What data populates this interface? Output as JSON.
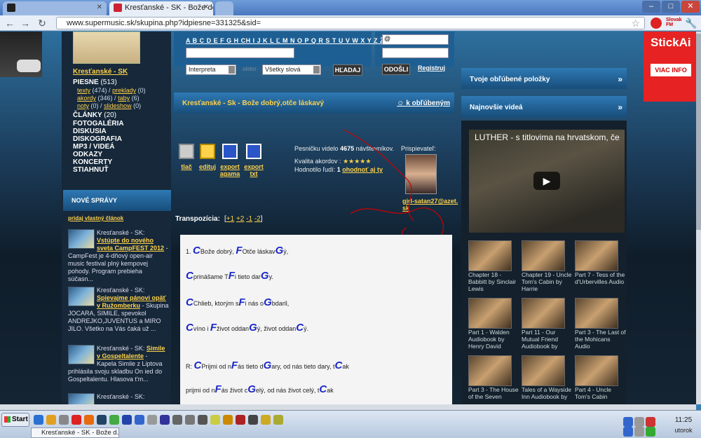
{
  "browser": {
    "tabs": [
      {
        "label": "",
        "active": false
      },
      {
        "label": "Kresťanské - SK - Bože dobrý",
        "active": true
      },
      {
        "label": "",
        "active": false
      }
    ],
    "url": "www.supermusic.sk/skupina.php?idpiesne=331325&sid=",
    "window_buttons": [
      "–",
      "□",
      "✕"
    ]
  },
  "search": {
    "alphabet": "A B C D E F G H CH I J K L Ľ M N O P Q R S T U V W X Y Z Ž",
    "interpret_select": "Interpreta",
    "mode_select": "Všetky slová",
    "search_button": "HĽADAJ",
    "or_label": "alebo",
    "email_prefix": "@",
    "login_button": "ODOŠLI",
    "register_link": "Registruj"
  },
  "artist": {
    "name": "Kresťanské - SK"
  },
  "left_menu": {
    "songs_label": "PIESNE",
    "songs_count": "(513)",
    "sub_items": [
      {
        "a": "texty",
        "ac": "(474)",
        "b": "preklady",
        "bc": "(0)"
      },
      {
        "a": "akordy",
        "ac": "(346)",
        "b": "taby",
        "bc": "(6)"
      },
      {
        "a": "noty",
        "ac": "(0)",
        "b": "slideshow",
        "bc": "(0)"
      }
    ],
    "articles_label": "ČLÁNKY",
    "articles_count": "(20)",
    "items": [
      "FOTOGALÉRIA",
      "DISKUSIA",
      "DISKOGRAFIA",
      "MP3 / VIDEÁ",
      "ODKAZY",
      "KONCERTY",
      "STIAHNUŤ"
    ]
  },
  "news": {
    "header": "NOVÉ SPRÁVY",
    "add_link": "pridaj vlastný článok",
    "items": [
      {
        "prefix": "Kresťanské - SK:",
        "title": "Vstúpte do nového sveta CampFEST 2012",
        "text": "- CampFest je 4-dňový open-air music festival plný kempovej pohody. Program prebieha súčasn..."
      },
      {
        "prefix": "Kresťanské - SK:",
        "title": "Spievajme pánovi opäť v Ružomberku",
        "text": "- Skupina JOCARA, SIMILE, spevokol ANDREJKO,JUVENTUS a MIRO JILO. Všetko na Vás čaká už ..."
      },
      {
        "prefix": "Kresťanské - SK:",
        "title": "Simile v Gospeltalente",
        "text": "- Kapela Simile z Liptova prihlásila svoju skladbu On ied do Gospeltalentu. Hlasova t'm..."
      },
      {
        "prefix": "Kresťanské - SK:",
        "title": "",
        "text": ""
      }
    ]
  },
  "song": {
    "title": "Kresťanské - Sk - Bože dobrý,otče láskavý",
    "favorite_link": "k obľúbeným",
    "tools": [
      {
        "label": "tlač",
        "icon": "printer-icon"
      },
      {
        "label": "edituj",
        "icon": "edit-icon"
      },
      {
        "label": "export agama",
        "icon": "floppy-icon"
      },
      {
        "label": "export txt",
        "icon": "floppy-icon"
      }
    ],
    "views_text": "Pesničku videlo",
    "views_count": "4675",
    "views_suffix": "návštevníkov.",
    "quality_label": "Kvalita akordov :",
    "quality_stars": "★★★★★",
    "rating_label": "Hodnotilo ľudí:",
    "rating_count": "1",
    "rate_link": "ohodnoť aj ty",
    "contributor_label": "Prispievateľ:",
    "contributor_name": "girl-satan27@azet.sk",
    "transposition_label": "Transpozícia:",
    "transposition_options": [
      "+1",
      "+2",
      "-1",
      "-2"
    ]
  },
  "lyrics": [
    [
      {
        "t": "1. "
      },
      {
        "c": "C"
      },
      {
        "t": "Bože dobrý, "
      },
      {
        "c": "F"
      },
      {
        "t": "Otče láskav"
      },
      {
        "c": "G"
      },
      {
        "t": "ý,"
      }
    ],
    [
      {
        "c": "C"
      },
      {
        "t": "prinášame T"
      },
      {
        "c": "F"
      },
      {
        "t": "i tieto dar"
      },
      {
        "c": "G"
      },
      {
        "t": "y."
      }
    ],
    [
      {
        "c": "C"
      },
      {
        "t": "Chlieb, ktorým s"
      },
      {
        "c": "F"
      },
      {
        "t": "i nás o"
      },
      {
        "c": "G"
      },
      {
        "t": "bdaril,"
      }
    ],
    [
      {
        "c": "C"
      },
      {
        "t": "víno i "
      },
      {
        "c": "F"
      },
      {
        "t": "život oddan"
      },
      {
        "c": "G"
      },
      {
        "t": "ý, život oddan"
      },
      {
        "c": "C"
      },
      {
        "t": "ý."
      }
    ],
    [
      {
        "t": "R: "
      },
      {
        "c": "C"
      },
      {
        "t": "Prijmi od n"
      },
      {
        "c": "F"
      },
      {
        "t": "ás tieto d"
      },
      {
        "c": "G"
      },
      {
        "t": "ary, od nás tieto dary, t"
      },
      {
        "c": "C"
      },
      {
        "t": "ak"
      }
    ],
    [
      {
        "t": "prijmi od n"
      },
      {
        "c": "F"
      },
      {
        "t": "ás život c"
      },
      {
        "c": "G"
      },
      {
        "t": "elý, od nás život celý, t"
      },
      {
        "c": "C"
      },
      {
        "t": "ak"
      }
    ]
  ],
  "right": {
    "favorites_bar": "Tvoje obľúbené položky",
    "videos_bar": "Najnovšie videá",
    "video_title": "LUTHER - s titlovima na hrvatskom, če",
    "thumbs": [
      {
        "caption": "Chapter 18 - Babbitt by Sinclair Lewis"
      },
      {
        "caption": "Chapter 19 - Uncle Tom's Cabin by Harrie"
      },
      {
        "caption": "Part 7 - Tess of the d'Urbervilles Audio"
      },
      {
        "caption": "Part 1 - Walden Audiobook by Henry David"
      },
      {
        "caption": "Part 11 - Our Mutual Friend Audiobook by"
      },
      {
        "caption": "Part 3 - The Last of the Mohicans Audio"
      },
      {
        "caption": "Part 3 - The House of the Seven"
      },
      {
        "caption": "Tales of a Wayside Inn Audiobook by"
      },
      {
        "caption": "Part 4 - Uncle Tom's Cabin"
      }
    ]
  },
  "ad": {
    "title": "StickAi",
    "button": "VIAC INFO"
  },
  "taskbar": {
    "start": "Start",
    "task_item": "Kresťanské - SK - Bože d...",
    "time": "11:25",
    "day": "utorok"
  },
  "colors": {
    "accent_yellow": "#ffd24a",
    "chord_blue": "#1a28c8",
    "ad_red": "#e62222"
  }
}
